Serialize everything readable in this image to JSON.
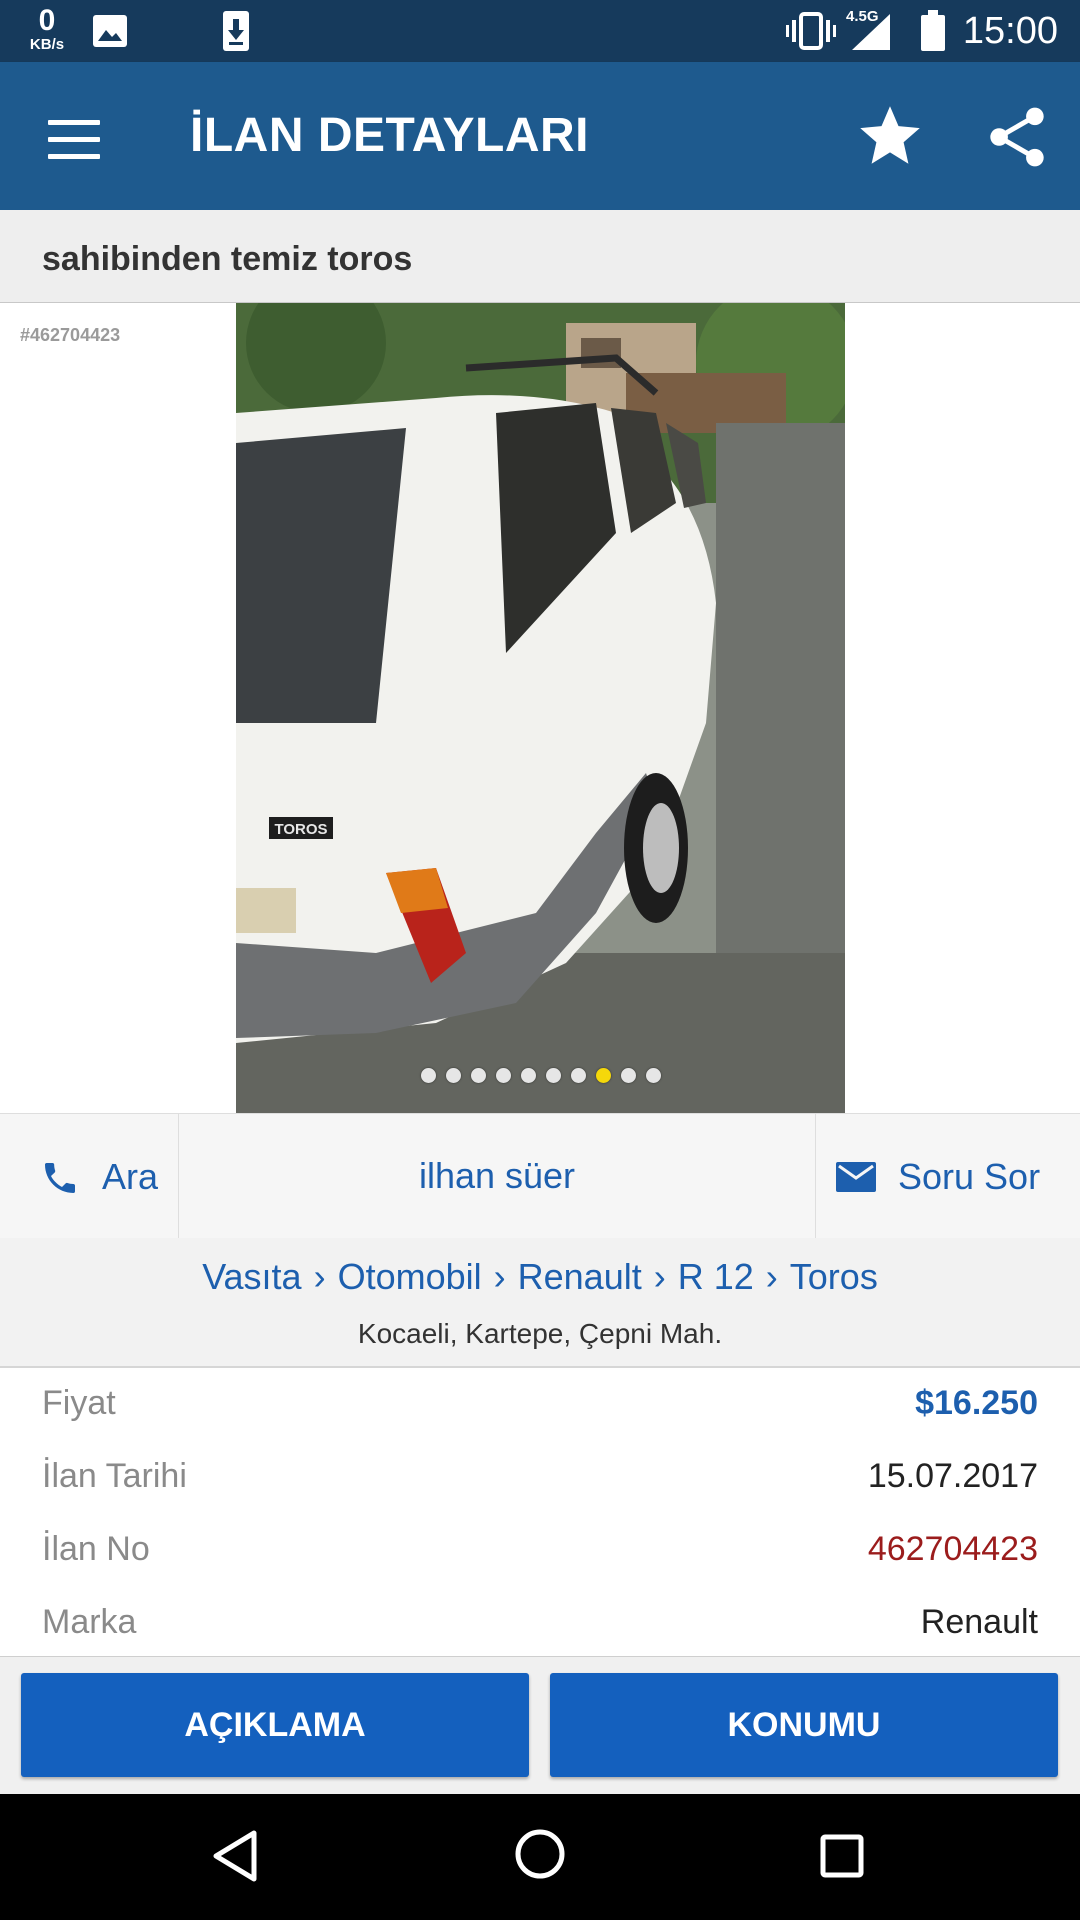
{
  "status_bar": {
    "net_speed": "0",
    "net_speed_unit": "KB/s",
    "network_type": "4.5G",
    "time": "15:00",
    "icons": [
      "image-icon",
      "download-icon",
      "vibrate-icon",
      "signal-icon",
      "battery-icon"
    ]
  },
  "app_bar": {
    "title": "İLAN DETAYLARI",
    "icons": [
      "menu-icon",
      "star-icon",
      "share-icon"
    ]
  },
  "listing": {
    "title": "sahibinden temiz toros",
    "watermark_id": "#462704423"
  },
  "gallery": {
    "image_count": 10,
    "active_index": 7,
    "photo_badge_text": "TOROS"
  },
  "actions": {
    "call_label": "Ara",
    "seller_name": "ilhan süer",
    "message_label": "Soru Sor"
  },
  "category": {
    "breadcrumb": [
      "Vasıta",
      "Otomobil",
      "Renault",
      "R 12",
      "Toros"
    ],
    "separator": "›",
    "location": "Kocaeli, Kartepe, Çepni Mah."
  },
  "details": [
    {
      "label": "Fiyat",
      "value": "$16.250"
    },
    {
      "label": "İlan Tarihi",
      "value": "15.07.2017"
    },
    {
      "label": "İlan No",
      "value": "462704423"
    },
    {
      "label": "Marka",
      "value": "Renault"
    }
  ],
  "bottom_buttons": {
    "description": "AÇIKLAMA",
    "location": "KONUMU"
  },
  "colors": {
    "app_bar": "#1e5a8e",
    "status_bar": "#163a5c",
    "link_blue": "#1d5fae",
    "price_blue": "#1d5fae",
    "listing_no_red": "#9b1c1c",
    "button_blue": "#1460be",
    "active_dot": "#f5d80a"
  }
}
